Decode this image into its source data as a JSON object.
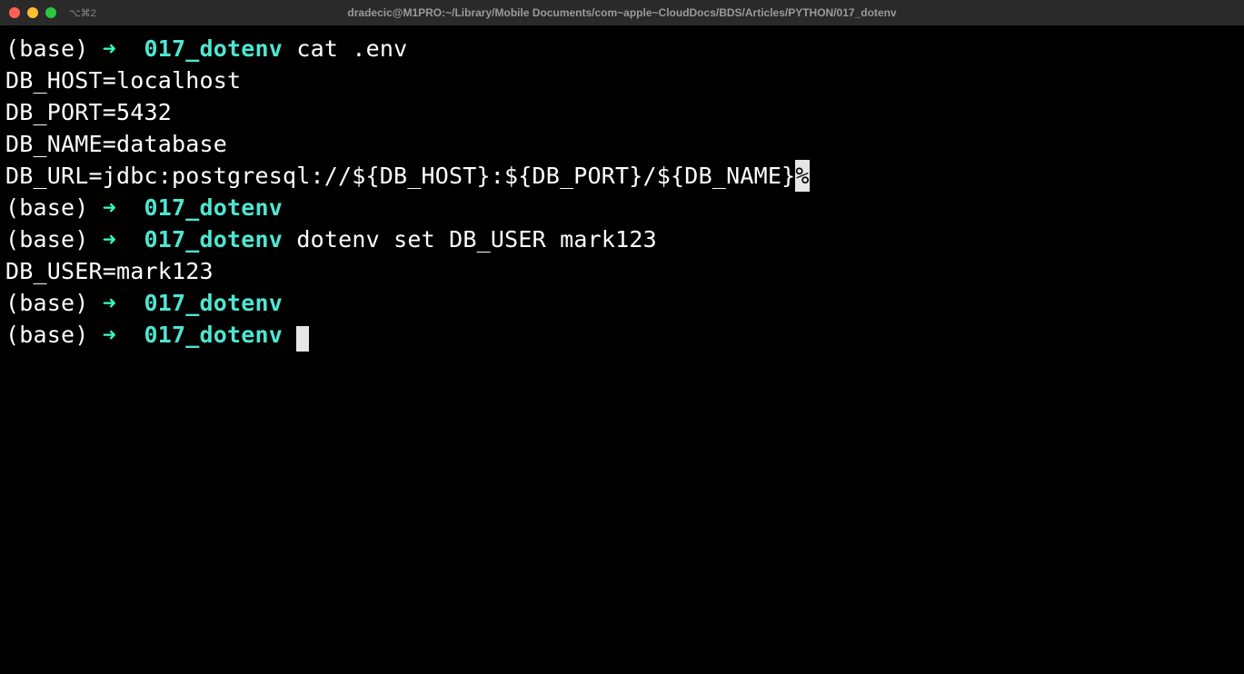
{
  "titlebar": {
    "title": "dradecic@M1PRO:~/Library/Mobile Documents/com~apple~CloudDocs/BDS/Articles/PYTHON/017_dotenv",
    "tab": "⌥⌘2"
  },
  "prompt": {
    "env": "(base)",
    "arrow": "➜",
    "dir": "017_dotenv"
  },
  "lines": [
    {
      "type": "prompt",
      "cmd": "cat .env"
    },
    {
      "type": "output_line",
      "text": "DB_HOST=localhost"
    },
    {
      "type": "output_line",
      "text": "DB_PORT=5432"
    },
    {
      "type": "output_line",
      "text": "DB_NAME=database"
    },
    {
      "type": "output_with_inv",
      "pre": "DB_URL=jdbc:postgresql://${DB_HOST}:${DB_PORT}/${DB_NAME}",
      "inv": "%"
    },
    {
      "type": "prompt",
      "cmd": ""
    },
    {
      "type": "prompt",
      "cmd": "dotenv set DB_USER mark123"
    },
    {
      "type": "output_line",
      "text": "DB_USER=mark123"
    },
    {
      "type": "prompt",
      "cmd": ""
    },
    {
      "type": "prompt_cursor"
    }
  ],
  "colors": {
    "bg": "#000000",
    "fg": "#ffffff",
    "accent": "#4ee6d1"
  }
}
